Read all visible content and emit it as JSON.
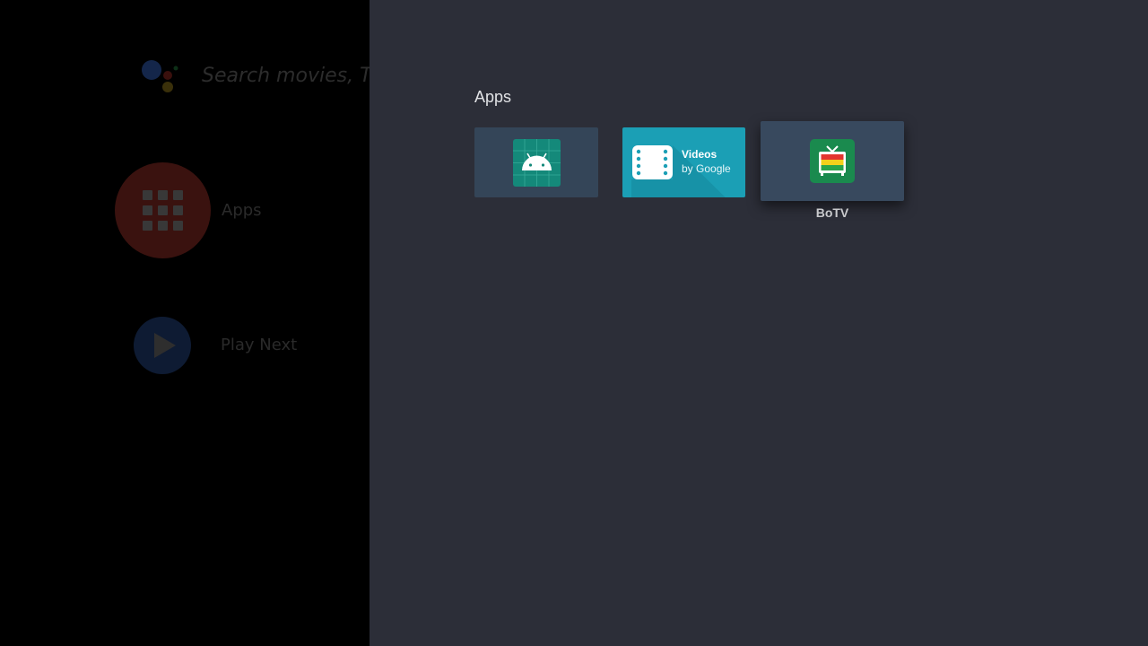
{
  "home": {
    "search_placeholder": "Search movies, TV",
    "rows": [
      {
        "label": "Apps",
        "icon": "apps-grid-icon"
      },
      {
        "label": "Play Next",
        "icon": "play-icon"
      }
    ]
  },
  "apps_panel": {
    "title": "Apps",
    "tiles": [
      {
        "icon": "android-icon",
        "label": ""
      },
      {
        "icon": "videos-by-google-icon",
        "banner_title": "Videos",
        "banner_subtitle": "by Google",
        "label": ""
      },
      {
        "icon": "tv-icon",
        "label": "BoTV",
        "focused": true
      }
    ]
  },
  "colors": {
    "panel_bg": "#2c2e38",
    "tile_bg": "#344558",
    "videos_tile_bg": "#1b9fb5",
    "android_icon_bg": "#14897a",
    "botv_icon_bg": "#1a8a4e"
  }
}
